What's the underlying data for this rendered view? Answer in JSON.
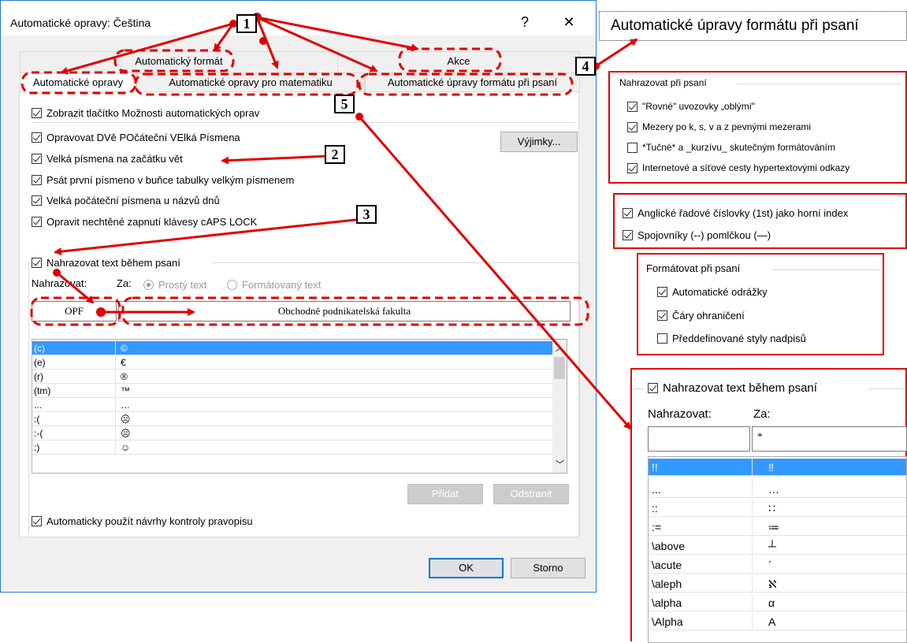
{
  "dialog": {
    "title": "Automatické opravy: Čeština",
    "help_label": "?",
    "close_label": "✕",
    "tabs_row1": [
      "Automatický formát",
      "Akce"
    ],
    "tabs_row2": [
      "Automatické opravy",
      "Automatické opravy pro matematiku",
      "Automatické úpravy formátu při psaní"
    ],
    "checkboxes": [
      {
        "label": "Zobrazit tlačítko Možnosti automatických oprav",
        "checked": true
      },
      {
        "label": "Opravovat DVě POčáteční VElká Písmena",
        "checked": true
      },
      {
        "label": "Velká písmena na začátku vět",
        "checked": true
      },
      {
        "label": "Psát první písmeno v buňce tabulky velkým písmenem",
        "checked": true
      },
      {
        "label": "Velká počáteční písmena u názvů dnů",
        "checked": true
      },
      {
        "label": "Opravit nechtěné zapnutí klávesy cAPS LOCK",
        "checked": true
      }
    ],
    "exceptions_button": "Výjimky...",
    "replace_group": {
      "checkbox_label": "Nahrazovat text během psaní",
      "replace_label": "Nahrazovat:",
      "with_label": "Za:",
      "radio_plain": "Prostý text",
      "radio_formatted": "Formátovaný text",
      "replace_value": "OPF",
      "with_value": "Obchodně podnikatelská fakulta"
    },
    "list_rows": [
      {
        "key": "(c)",
        "value": "©"
      },
      {
        "key": "(e)",
        "value": "€"
      },
      {
        "key": "(r)",
        "value": "®"
      },
      {
        "key": "(tm)",
        "value": "™"
      },
      {
        "key": "...",
        "value": "…"
      },
      {
        "key": ":(",
        "value": "☹"
      },
      {
        "key": ":-(",
        "value": "☹"
      },
      {
        "key": ":)",
        "value": "☺"
      }
    ],
    "add_button": "Přidat",
    "remove_button": "Odstranit",
    "spell_checkbox": "Automaticky použít návrhy kontroly pravopisu",
    "ok_button": "OK",
    "cancel_button": "Storno"
  },
  "crop_title": "Automatické úpravy formátu při psaní",
  "crop_replace_while_typing": {
    "group_label": "Nahrazovat při psaní",
    "items": [
      {
        "label": "\"Rovné\" uvozovky „oblými\"",
        "checked": true
      },
      {
        "label": "Mezery po k, s, v a z pevnými mezerami",
        "checked": true
      },
      {
        "label": "*Tučné* a _kurzívu_ skutečným formátováním",
        "checked": false
      },
      {
        "label": "Internetové a síťové cesty hypertextovými odkazy",
        "checked": true
      }
    ]
  },
  "crop_ordinals": {
    "items": [
      {
        "label": "Anglické řadové číslovky (1st) jako horní index",
        "checked": true
      },
      {
        "label": "Spojovníky (--) pomlčkou (—)",
        "checked": true
      }
    ]
  },
  "crop_format_while_typing": {
    "group_label": "Formátovat při psaní",
    "items": [
      {
        "label": "Automatické odrážky",
        "checked": true
      },
      {
        "label": "Čáry ohraničení",
        "checked": true
      },
      {
        "label": "Předdefinované styly nadpisů",
        "checked": false
      }
    ]
  },
  "crop_math": {
    "checkbox_label": "Nahrazovat text během psaní",
    "replace_label": "Nahrazovat:",
    "with_label": "Za:",
    "with_value": "*",
    "rows": [
      {
        "key": "!!",
        "value": "‼"
      },
      {
        "key": "...",
        "value": "…"
      },
      {
        "key": "::",
        "value": "∷"
      },
      {
        "key": ":=",
        "value": "≔"
      },
      {
        "key": "\\above",
        "value": "┴"
      },
      {
        "key": "\\acute",
        "value": "´"
      },
      {
        "key": "\\aleph",
        "value": "ℵ"
      },
      {
        "key": "\\alpha",
        "value": "α"
      },
      {
        "key": "\\Alpha",
        "value": "A"
      }
    ]
  },
  "annotations": [
    "1",
    "2",
    "3",
    "4",
    "5"
  ],
  "colors": {
    "annotation": "#e00000",
    "selection": "#3399ff",
    "dialog_border": "#2b79d0"
  }
}
